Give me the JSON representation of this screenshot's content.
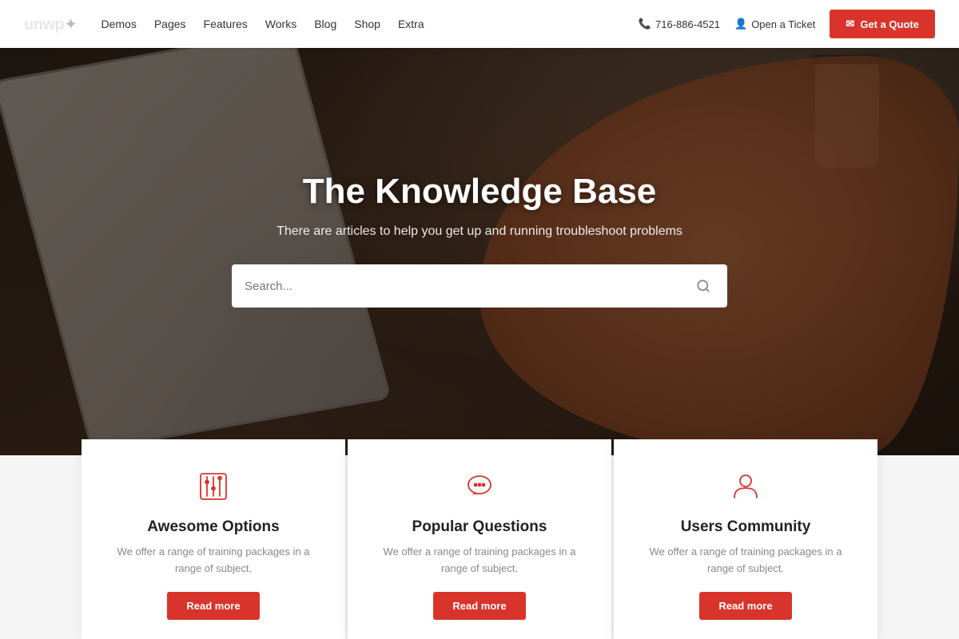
{
  "header": {
    "logo": "unwp",
    "nav": [
      {
        "label": "Demos",
        "id": "demos"
      },
      {
        "label": "Pages",
        "id": "pages"
      },
      {
        "label": "Features",
        "id": "features"
      },
      {
        "label": "Works",
        "id": "works"
      },
      {
        "label": "Blog",
        "id": "blog"
      },
      {
        "label": "Shop",
        "id": "shop"
      },
      {
        "label": "Extra",
        "id": "extra"
      }
    ],
    "phone": "716-886-4521",
    "ticket_label": "Open a Ticket",
    "quote_label": "Get a Quote"
  },
  "hero": {
    "title": "The Knowledge Base",
    "subtitle": "There are articles to help you get up and running troubleshoot problems",
    "search_placeholder": "Search..."
  },
  "cards": [
    {
      "id": "awesome-options",
      "icon": "sliders-icon",
      "title": "Awesome Options",
      "desc": "We offer a range of training packages in a range of subject.",
      "btn": "Read more"
    },
    {
      "id": "popular-questions",
      "icon": "chat-icon",
      "title": "Popular Questions",
      "desc": "We offer a range of training packages in a range of subject.",
      "btn": "Read more"
    },
    {
      "id": "users-community",
      "icon": "user-icon",
      "title": "Users Community",
      "desc": "We offer a range of training packages in a range of subject.",
      "btn": "Read more"
    }
  ],
  "colors": {
    "accent": "#d9342b",
    "text_dark": "#222222",
    "text_mid": "#555555",
    "text_light": "#888888"
  }
}
